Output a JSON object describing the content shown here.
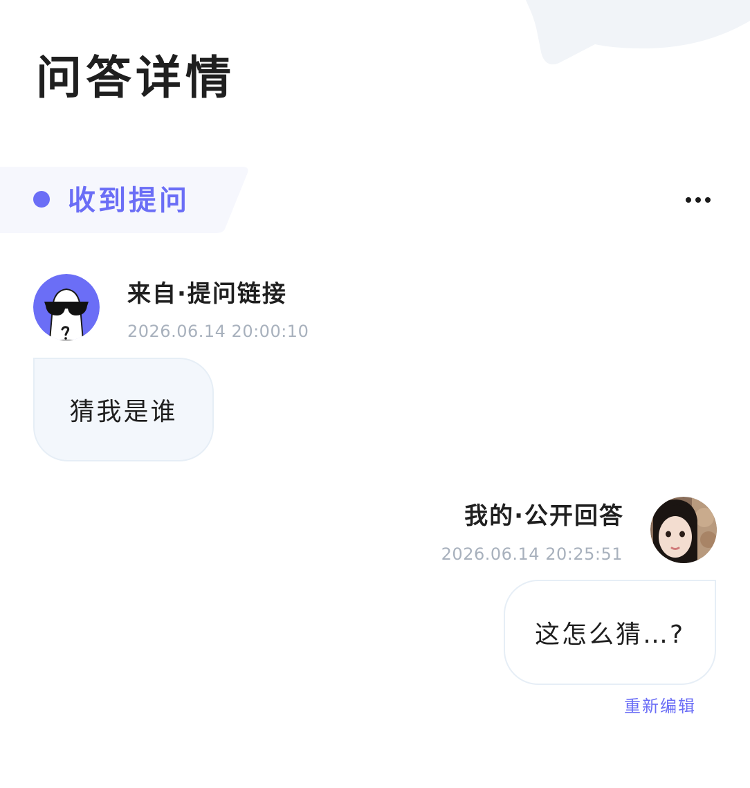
{
  "page": {
    "title": "问答详情"
  },
  "section": {
    "label": "收到提问"
  },
  "menu": {
    "icon": "more-horizontal-icon"
  },
  "question": {
    "sender": "来自·提问链接",
    "time": "2026.06.14 20:00:10",
    "text": "猜我是谁",
    "avatar_icon": "anonymous-sunglasses-avatar"
  },
  "answer": {
    "sender": "我的·公开回答",
    "time": "2026.06.14 20:25:51",
    "text": "这怎么猜…?",
    "edit_label": "重新编辑",
    "avatar_icon": "user-photo-avatar"
  },
  "colors": {
    "accent": "#6b6ef6",
    "muted_text": "#a8b1bd",
    "bubble_bg": "#f3f7fc",
    "bubble_border": "#e6eef6",
    "tab_bg": "#f6f7fd"
  }
}
